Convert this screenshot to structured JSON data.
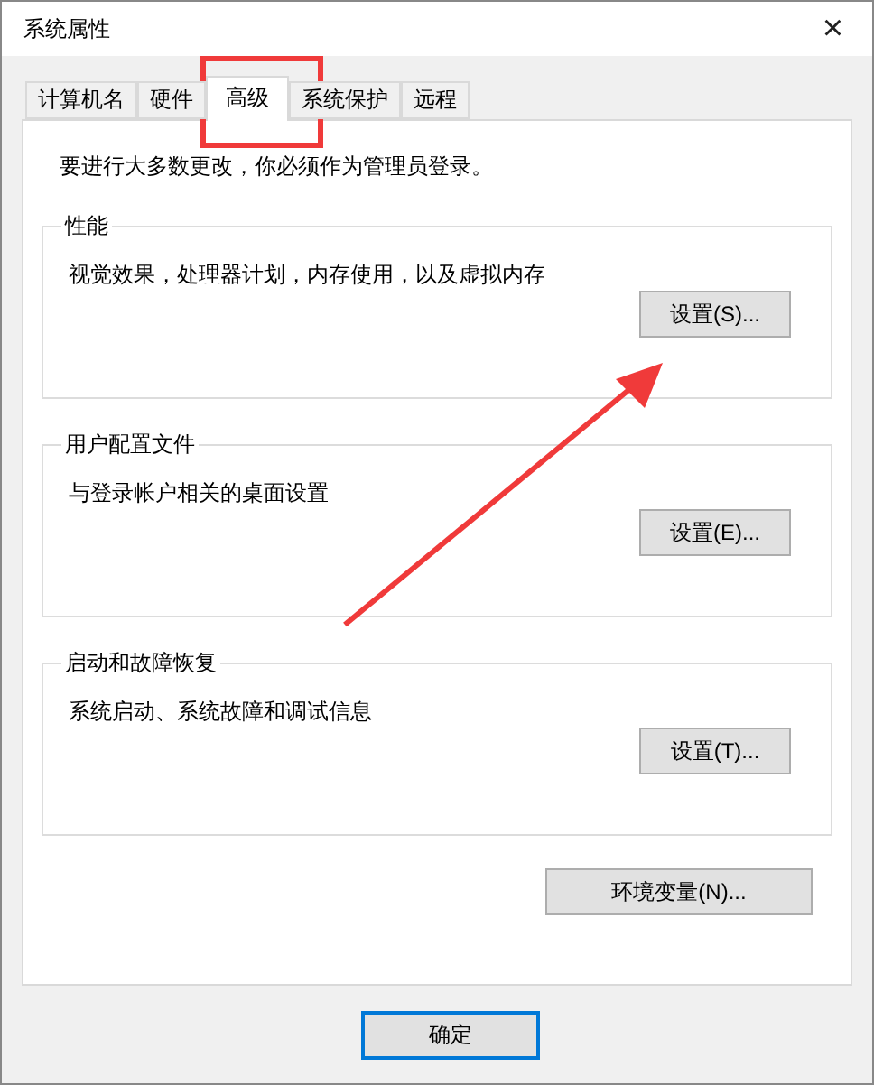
{
  "window": {
    "title": "系统属性",
    "close": "×"
  },
  "tabs": [
    {
      "label": "计算机名",
      "selected": false
    },
    {
      "label": "硬件",
      "selected": false
    },
    {
      "label": "高级",
      "selected": true
    },
    {
      "label": "系统保护",
      "selected": false
    },
    {
      "label": "远程",
      "selected": false
    }
  ],
  "notice": "要进行大多数更改，你必须作为管理员登录。",
  "groups": [
    {
      "title": "性能",
      "description": "视觉效果，处理器计划，内存使用，以及虚拟内存",
      "button": "设置(S)..."
    },
    {
      "title": "用户配置文件",
      "description": "与登录帐户相关的桌面设置",
      "button": "设置(E)..."
    },
    {
      "title": "启动和故障恢复",
      "description": "系统启动、系统故障和调试信息",
      "button": "设置(T)..."
    }
  ],
  "env_button": "环境变量(N)...",
  "footer_buttons": [
    {
      "label": "确定",
      "default": true
    }
  ]
}
